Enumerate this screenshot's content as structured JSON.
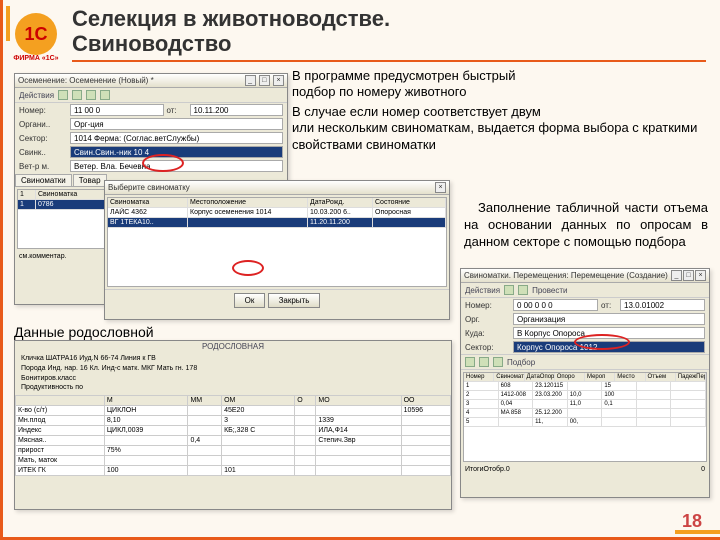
{
  "page": {
    "title": "Селекция в животноводстве.\nСвиноводство",
    "logo_text": "1С",
    "logo_sub": "ФИРМА «1С»",
    "page_num": "18"
  },
  "paras": {
    "p1_indent": "   В программе предусмотрен быстрый",
    "p1_rest": "подбор по номеру животного",
    "p2_indent": "   В случае если номер соответствует двум",
    "p2_rest": "или нескольким свиноматкам, выдается форма выбора с краткими свойствами свиноматки",
    "p3": "Заполнение табличной части отъема на основании данных по опросам в данном секторе с помощью подбора",
    "subhead": "Данные родословной"
  },
  "win1": {
    "title": "Осеменение: Осеменение (Новый) *",
    "tb_action": "Действия",
    "rows": {
      "number_l": "Номер:",
      "number_v": "11 00  0",
      "date_l": "от:",
      "date_v": "10.11.200",
      "org_l": "Органи..",
      "org_v": "Орг-ция",
      "sector_l": "Сектор:",
      "sector_v": "1014 Ферма: (Соглас.ветСлужбы)",
      "sow_l": "Свинк..",
      "sow_v": "Свин.Свин.-ник 10 4",
      "vet_l": "Вет-р м.",
      "vet_v": "Ветер. Вла. Бечевна",
      "tab1": "Свиноматки",
      "tab2": "Товар"
    },
    "grid": {
      "h1": "1",
      "h2": "Свиноматка",
      "r1c1": "1",
      "r1c2": "0786"
    },
    "footer": "см.комментар."
  },
  "popup": {
    "title": "Выберите свиноматку",
    "h1": "Свиноматка",
    "h2": "Местоположение",
    "h3": "ДатаРожд.",
    "h4": "Состояние",
    "r1": {
      "c1": "ЛАЙС 4362",
      "c2": "Корпус осеменения 1014",
      "c3": "10.03.200 6..",
      "c4": "Опоросная"
    },
    "r2": {
      "c1": "ВГ 1ТЕКА10..",
      "c2": "",
      "c3": "11.20.11.200",
      "c4": ""
    },
    "ok": "Ок",
    "cancel": "Закрыть"
  },
  "win2": {
    "title": "Свиноматки. Перемещения: Перемещение (Создание)",
    "tb": "Действия",
    "submit": "Провести",
    "rows": {
      "num_l": "Номер:",
      "num_v": "0 00 0 0 0",
      "from_l": "от:",
      "from_v": "13.0.01002",
      "org_l": "Орг.",
      "org_v": "Организация",
      "where_l": "Куда:",
      "where_v": "В Корпус Опороса",
      "sector_l": "Сектор:",
      "sector_v": "Корпус Опороса 1012",
      "pick": "Подбор"
    },
    "gridh": [
      "Номер",
      "Свиномат",
      "ДатаОпор",
      "Опоро",
      "Мероп",
      "Место",
      "Отъем",
      "ПадежПере.."
    ],
    "gridr": [
      [
        "1",
        "608",
        "23.120115",
        "",
        "15",
        "",
        ""
      ],
      [
        "2",
        "1412-008",
        "23.03.200",
        "10,0",
        "100",
        "",
        ""
      ],
      [
        "3",
        "0,04",
        "",
        "11,0",
        "0,1",
        "",
        ""
      ],
      [
        "4",
        "MA 858",
        "25.12.200",
        "",
        "",
        "",
        ""
      ],
      [
        "5",
        "",
        "11,",
        "00,",
        "",
        "",
        ""
      ]
    ],
    "footer_l": "ИтогиОтобр.0",
    "footer_r": "0"
  },
  "pedigree": {
    "title": "РОДОСЛОВНАЯ",
    "head": {
      "l1a": "Кличка ШАТРА16  Иуд.N 66-74   Линия к ГВ",
      "l1b": "Порода        Инд. нар. 16 Кл.  Инд-с матк. МКГ   Мать гн. 178",
      "l2": "Бонитиров.класс",
      "l3": "Продуктивность по"
    },
    "cols": [
      "",
      "М",
      "ММ",
      "ОМ",
      "О",
      "МО",
      "ОО"
    ],
    "rows": [
      [
        "К-во (с/т)",
        "ЦИКЛОН",
        "",
        "45E20",
        "",
        "",
        "10596"
      ],
      [
        "Мн.плод",
        "8,10",
        "",
        "3",
        "",
        "1339",
        ""
      ],
      [
        "Индекс",
        "ЦИКЛ,0039",
        "",
        "КБ;,328 С",
        "",
        "ИЛА,Ф14",
        ""
      ],
      [
        "Мясная..",
        "",
        "0,4",
        "",
        "",
        "Степич.Звр",
        ""
      ],
      [
        "прирост",
        "75%",
        "",
        "",
        "",
        "",
        ""
      ],
      [
        "Мать, маток",
        "",
        "",
        "",
        "",
        "",
        ""
      ],
      [
        "ИТЕК ГК",
        "100",
        "",
        "101",
        "",
        "",
        ""
      ]
    ]
  }
}
